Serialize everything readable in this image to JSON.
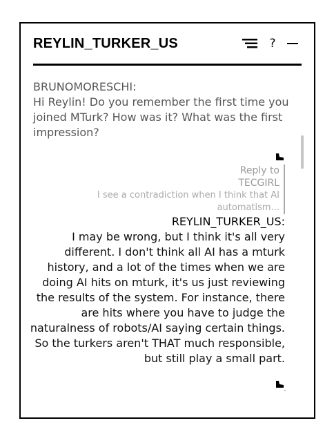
{
  "window": {
    "title": "REYLIN_TURKER_US",
    "controls": {
      "menu_icon": "menu-lines-icon",
      "help_label": "?",
      "minimize_icon": "minimize-icon"
    }
  },
  "messages": [
    {
      "author": "BRUNOMORESCHI:",
      "text": "Hi Reylin! Do you remember the first time you joined MTurk? How was it? What was the first impression?",
      "reply_icon": "reply-arrow-icon"
    },
    {
      "reply_to": {
        "label_line1": "Reply to",
        "label_line2": "TECGIRL",
        "quoted_text": "I see a contradiction when I think that AI automatism..."
      },
      "author": "REYLIN_TURKER_US:",
      "text": "I may be wrong, but I think it's all very different. I don't think all AI has a mturk history, and a lot of the times when we are doing AI hits on mturk, it's us just reviewing the results of the system. For instance, there are hits where you have to judge the naturalness of robots/AI saying certain things. So the turkers aren't THAT much responsible, but still play a small part.",
      "reply_icon": "reply-arrow-icon"
    }
  ],
  "colors": {
    "border": "#000000",
    "primary_text": "#111111",
    "secondary_text": "#555555",
    "muted_text": "#9a9a9a",
    "scrollbar": "#c6c6c6"
  }
}
